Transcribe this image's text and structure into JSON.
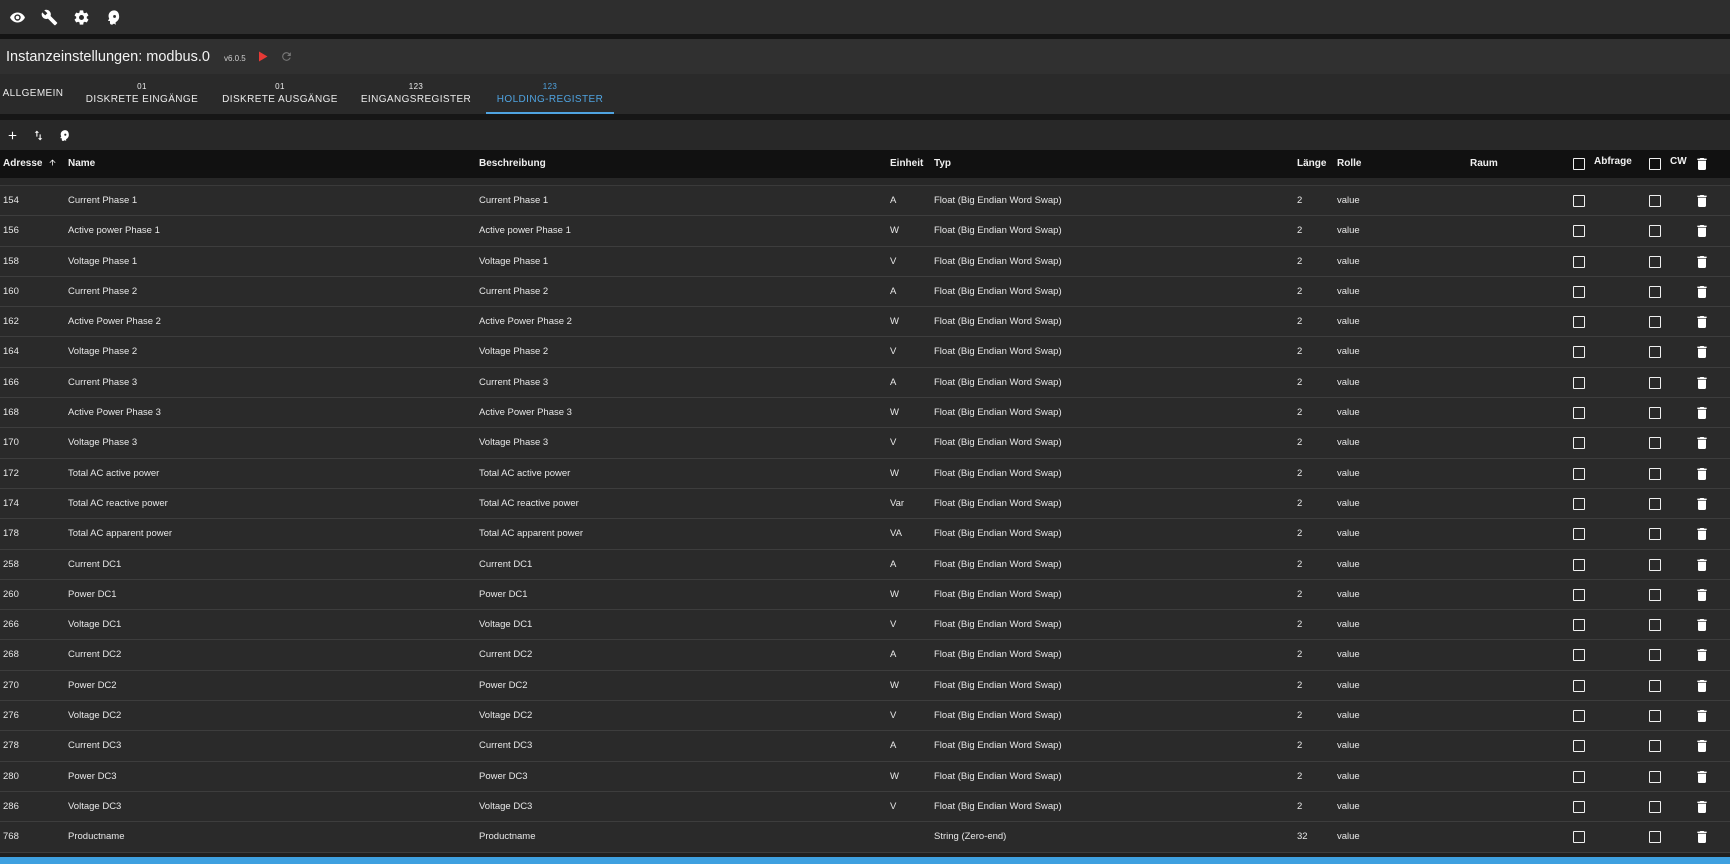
{
  "topbar": {
    "icons": [
      "eye-icon",
      "wrench-icon",
      "gear-icon",
      "expert-head-icon"
    ]
  },
  "header": {
    "title": "Instanzeinstellungen: modbus.0",
    "version": "v6.0.5"
  },
  "tabs": [
    {
      "sup": "",
      "label": "ALLGEMEIN"
    },
    {
      "sup": "01",
      "label": "DISKRETE EINGÄNGE"
    },
    {
      "sup": "01",
      "label": "DISKRETE AUSGÄNGE"
    },
    {
      "sup": "123",
      "label": "EINGANGSREGISTER"
    },
    {
      "sup": "123",
      "label": "HOLDING-REGISTER"
    }
  ],
  "active_tab": "HOLDING-REGISTER",
  "table": {
    "headers": {
      "address": "Adresse",
      "name": "Name",
      "description": "Beschreibung",
      "unit": "Einheit",
      "type": "Typ",
      "length": "Länge",
      "role": "Rolle",
      "room": "Raum",
      "poll": "Abfrage",
      "cw": "CW"
    },
    "rows": [
      {
        "address": "154",
        "name": "Current Phase 1",
        "description": "Current Phase 1",
        "unit": "A",
        "type": "Float (Big Endian Word Swap)",
        "length": "2",
        "role": "value",
        "room": ""
      },
      {
        "address": "156",
        "name": "Active power Phase 1",
        "description": "Active power Phase 1",
        "unit": "W",
        "type": "Float (Big Endian Word Swap)",
        "length": "2",
        "role": "value",
        "room": ""
      },
      {
        "address": "158",
        "name": "Voltage Phase 1",
        "description": "Voltage Phase 1",
        "unit": "V",
        "type": "Float (Big Endian Word Swap)",
        "length": "2",
        "role": "value",
        "room": ""
      },
      {
        "address": "160",
        "name": "Current Phase 2",
        "description": "Current Phase 2",
        "unit": "A",
        "type": "Float (Big Endian Word Swap)",
        "length": "2",
        "role": "value",
        "room": ""
      },
      {
        "address": "162",
        "name": "Active Power Phase 2",
        "description": "Active Power Phase 2",
        "unit": "W",
        "type": "Float (Big Endian Word Swap)",
        "length": "2",
        "role": "value",
        "room": ""
      },
      {
        "address": "164",
        "name": "Voltage Phase 2",
        "description": "Voltage Phase 2",
        "unit": "V",
        "type": "Float (Big Endian Word Swap)",
        "length": "2",
        "role": "value",
        "room": ""
      },
      {
        "address": "166",
        "name": "Current Phase 3",
        "description": "Current Phase 3",
        "unit": "A",
        "type": "Float (Big Endian Word Swap)",
        "length": "2",
        "role": "value",
        "room": ""
      },
      {
        "address": "168",
        "name": "Active Power Phase 3",
        "description": "Active Power Phase 3",
        "unit": "W",
        "type": "Float (Big Endian Word Swap)",
        "length": "2",
        "role": "value",
        "room": ""
      },
      {
        "address": "170",
        "name": "Voltage Phase 3",
        "description": "Voltage Phase 3",
        "unit": "V",
        "type": "Float (Big Endian Word Swap)",
        "length": "2",
        "role": "value",
        "room": ""
      },
      {
        "address": "172",
        "name": "Total AC active power",
        "description": "Total AC active power",
        "unit": "W",
        "type": "Float (Big Endian Word Swap)",
        "length": "2",
        "role": "value",
        "room": ""
      },
      {
        "address": "174",
        "name": "Total AC reactive power",
        "description": "Total AC reactive power",
        "unit": "Var",
        "type": "Float (Big Endian Word Swap)",
        "length": "2",
        "role": "value",
        "room": ""
      },
      {
        "address": "178",
        "name": "Total AC apparent power",
        "description": "Total AC apparent power",
        "unit": "VA",
        "type": "Float (Big Endian Word Swap)",
        "length": "2",
        "role": "value",
        "room": ""
      },
      {
        "address": "258",
        "name": "Current DC1",
        "description": "Current DC1",
        "unit": "A",
        "type": "Float (Big Endian Word Swap)",
        "length": "2",
        "role": "value",
        "room": ""
      },
      {
        "address": "260",
        "name": "Power DC1",
        "description": "Power DC1",
        "unit": "W",
        "type": "Float (Big Endian Word Swap)",
        "length": "2",
        "role": "value",
        "room": ""
      },
      {
        "address": "266",
        "name": "Voltage DC1",
        "description": "Voltage DC1",
        "unit": "V",
        "type": "Float (Big Endian Word Swap)",
        "length": "2",
        "role": "value",
        "room": ""
      },
      {
        "address": "268",
        "name": "Current DC2",
        "description": "Current DC2",
        "unit": "A",
        "type": "Float (Big Endian Word Swap)",
        "length": "2",
        "role": "value",
        "room": ""
      },
      {
        "address": "270",
        "name": "Power DC2",
        "description": "Power DC2",
        "unit": "W",
        "type": "Float (Big Endian Word Swap)",
        "length": "2",
        "role": "value",
        "room": ""
      },
      {
        "address": "276",
        "name": "Voltage DC2",
        "description": "Voltage DC2",
        "unit": "V",
        "type": "Float (Big Endian Word Swap)",
        "length": "2",
        "role": "value",
        "room": ""
      },
      {
        "address": "278",
        "name": "Current DC3",
        "description": "Current DC3",
        "unit": "A",
        "type": "Float (Big Endian Word Swap)",
        "length": "2",
        "role": "value",
        "room": ""
      },
      {
        "address": "280",
        "name": "Power DC3",
        "description": "Power DC3",
        "unit": "W",
        "type": "Float (Big Endian Word Swap)",
        "length": "2",
        "role": "value",
        "room": ""
      },
      {
        "address": "286",
        "name": "Voltage DC3",
        "description": "Voltage DC3",
        "unit": "V",
        "type": "Float (Big Endian Word Swap)",
        "length": "2",
        "role": "value",
        "room": ""
      },
      {
        "address": "768",
        "name": "Productname",
        "description": "Productname",
        "unit": "",
        "type": "String (Zero-end)",
        "length": "32",
        "role": "value",
        "room": ""
      }
    ]
  },
  "colors": {
    "accent": "#4fa3e0",
    "play": "#e53935",
    "background": "#2a2a2a",
    "header_bg": "#111111"
  }
}
